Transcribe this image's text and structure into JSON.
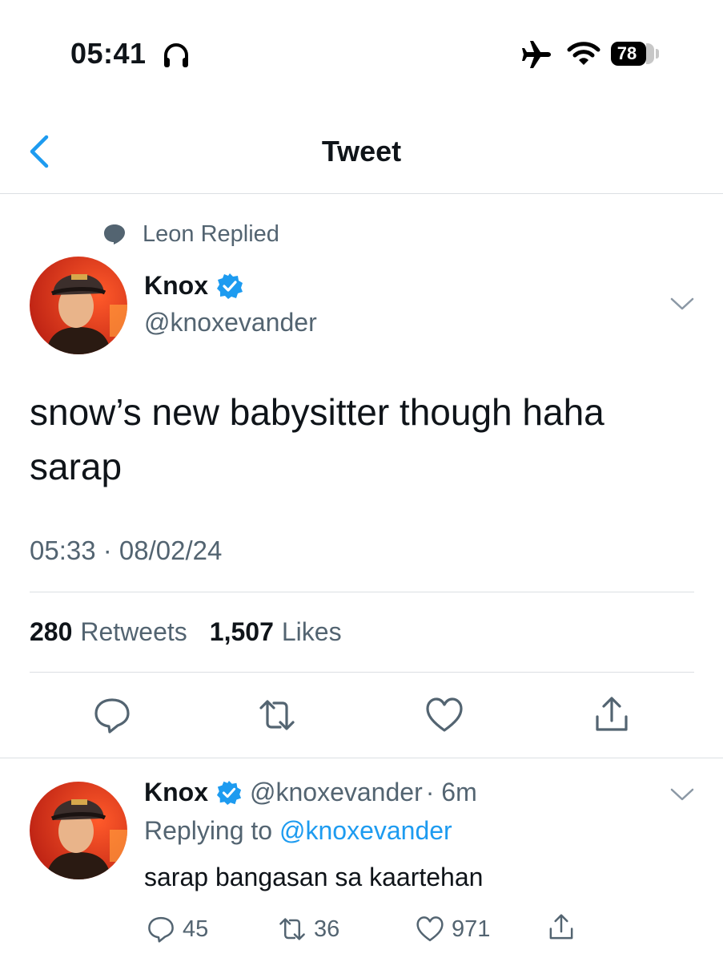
{
  "status_bar": {
    "time": "05:41",
    "battery": "78",
    "icons": [
      "headphones-icon",
      "airplane-icon",
      "wifi-icon",
      "battery-icon"
    ]
  },
  "header": {
    "title": "Tweet",
    "back_icon": "chevron-left-icon"
  },
  "colors": {
    "accent": "#1d9bf0",
    "muted": "#536471",
    "text": "#0f1419",
    "divider": "#dcdfe3"
  },
  "main_tweet": {
    "context": "Leon Replied",
    "author_name": "Knox",
    "author_handle": "@knoxevander",
    "text": "snow’s new babysitter though haha sarap",
    "timestamp": "05:33 · 08/02/24",
    "retweets_count": "280",
    "retweets_label": "Retweets",
    "likes_count": "1,507",
    "likes_label": "Likes"
  },
  "reply": {
    "author_name": "Knox",
    "author_handle": "@knoxevander",
    "time_ago": "· 6m",
    "replying_prefix": "Replying to",
    "replying_handle": "@knoxevander",
    "text": "sarap bangasan sa kaartehan",
    "reply_count": "45",
    "retweet_count": "36",
    "like_count": "971"
  }
}
